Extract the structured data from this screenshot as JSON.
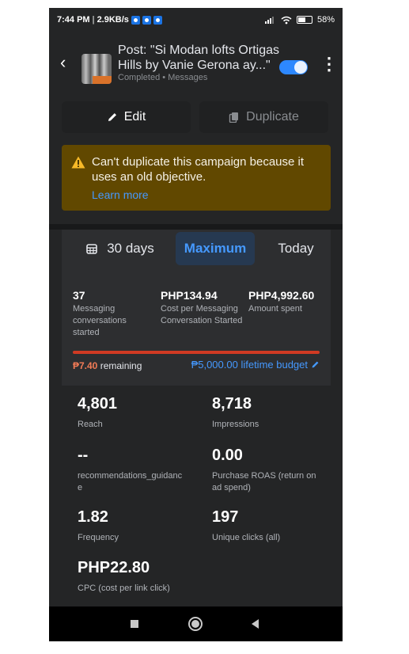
{
  "status_bar": {
    "time": "7:44 PM",
    "speed": "2.9KB/s",
    "battery": "58",
    "battery_level_percent": 58
  },
  "header": {
    "title": "Post: \"Si Modan lofts Ortigas Hills by Vanie Gerona ay...\"",
    "status": "Completed",
    "separator": "•",
    "objective": "Messages",
    "toggle_on": true
  },
  "actions": {
    "edit_label": "Edit",
    "duplicate_label": "Duplicate"
  },
  "warning": {
    "text": "Can't duplicate this campaign because it uses an old objective.",
    "link": "Learn more"
  },
  "date_range": {
    "tabs": [
      {
        "label": "30 days"
      },
      {
        "label": "Maximum",
        "selected": true
      },
      {
        "label": "Today"
      }
    ]
  },
  "summary": [
    {
      "value": "37",
      "label": "Messaging conversations started"
    },
    {
      "value": "PHP134.94",
      "label": "Cost per Messaging Conversation Started"
    },
    {
      "value": "PHP4,992.60",
      "label": "Amount spent"
    }
  ],
  "budget": {
    "remaining_amount": "₱7.40",
    "remaining_suffix": "remaining",
    "lifetime": "₱5,000.00 lifetime budget",
    "spent_fraction": 0.9985
  },
  "metrics": [
    {
      "value": "4,801",
      "label": "Reach"
    },
    {
      "value": "8,718",
      "label": "Impressions"
    },
    {
      "value": "--",
      "label": "recommendations_guidance"
    },
    {
      "value": "0.00",
      "label": "Purchase ROAS (return on ad spend)"
    },
    {
      "value": "1.82",
      "label": "Frequency"
    },
    {
      "value": "197",
      "label": "Unique clicks (all)"
    },
    {
      "value": "PHP22.80",
      "label": "CPC (cost per link click)"
    }
  ],
  "colors": {
    "background": "#242526",
    "accent": "#2d88ff",
    "warning_bg": "#614800",
    "budget_bar": "#d03a23"
  }
}
